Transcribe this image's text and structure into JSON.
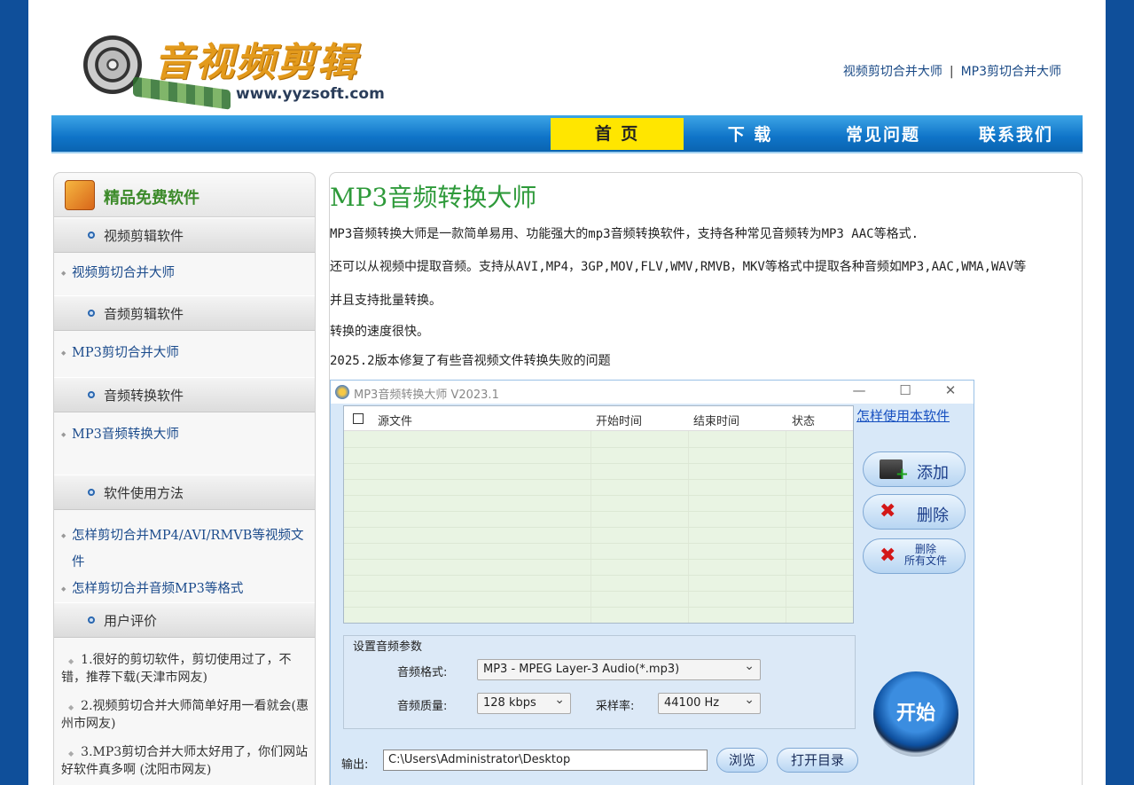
{
  "header": {
    "logo_title": "音视频剪辑",
    "logo_url": "www.yyzsoft.com",
    "top_links": [
      "视频剪切合并大师",
      "MP3剪切合并大师"
    ],
    "top_sep": "|"
  },
  "nav": [
    {
      "label": "首 页",
      "active": true
    },
    {
      "label": "下 载",
      "active": false
    },
    {
      "label": "常见问题",
      "active": false
    },
    {
      "label": "联系我们",
      "active": false
    }
  ],
  "sidebar": {
    "title": "精品免费软件",
    "categories": [
      {
        "title": "视频剪辑软件",
        "links": [
          "视频剪切合并大师"
        ]
      },
      {
        "title": "音频剪辑软件",
        "links": [
          "MP3剪切合并大师"
        ]
      },
      {
        "title": "音频转换软件",
        "links": [
          "MP3音频转换大师"
        ]
      },
      {
        "title": "软件使用方法",
        "links": [
          "怎样剪切合并MP4/AVI/RMVB等视频文件",
          "怎样剪切合并音频MP3等格式"
        ]
      },
      {
        "title": "用户评价",
        "links": []
      }
    ],
    "reviews": [
      "1.很好的剪切软件，剪切使用过了，不错，推荐下载(天津市网友)",
      "2.视频剪切合并大师简单好用一看就会(惠州市网友)",
      "3.MP3剪切合并大师太好用了，你们网站好软件真多啊 (沈阳市网友)"
    ]
  },
  "main": {
    "title": "MP3音频转换大师",
    "paragraphs": [
      "MP3音频转换大师是一款简单易用、功能强大的mp3音频转换软件，支持各种常见音频转为MP3 AAC等格式.",
      "还可以从视频中提取音频。支持从AVI,MP4，3GP,MOV,FLV,WMV,RMVB，MKV等格式中提取各种音频如MP3,AAC,WMA,WAV等",
      "并且支持批量转换。",
      "转换的速度很快。",
      "2025.2版本修复了有些音视频文件转换失败的问题"
    ]
  },
  "app": {
    "title": "MP3音频转换大师 V2023.1",
    "window_buttons": [
      "—",
      "☐",
      "✕"
    ],
    "columns": [
      "源文件",
      "开始时间",
      "结束时间",
      "状态"
    ],
    "help_link": "怎样使用本软件",
    "add_label": "添加",
    "delete_label": "删除",
    "delete_all_label": "删除\n所有文件",
    "params_title": "设置音频参数",
    "format_label": "音频格式:",
    "format_value": "MP3 - MPEG Layer-3 Audio(*.mp3)",
    "quality_label": "音频质量:",
    "quality_value": "128 kbps",
    "rate_label": "采样率:",
    "rate_value": "44100 Hz",
    "start_label": "开始",
    "output_label": "输出:",
    "output_value": "C:\\Users\\Administrator\\Desktop",
    "browse_label": "浏览",
    "open_dir_label": "打开目录"
  }
}
